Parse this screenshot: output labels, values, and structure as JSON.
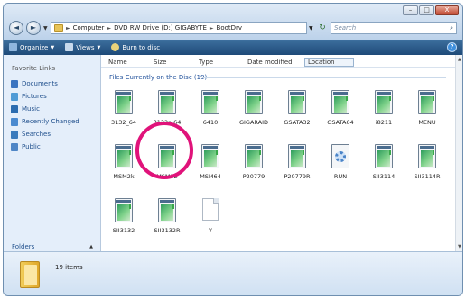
{
  "window": {
    "controls": {
      "minimize": "–",
      "maximize": "□",
      "close": "X"
    }
  },
  "nav": {
    "back_glyph": "◄",
    "forward_glyph": "►",
    "path": [
      "Computer",
      "DVD RW Drive (D:) GIGABYTE",
      "BootDrv"
    ],
    "search_placeholder": "Search"
  },
  "toolbar": {
    "organize": "Organize",
    "views": "Views",
    "burn": "Burn to disc",
    "help": "?"
  },
  "sidebar": {
    "title": "Favorite Links",
    "items": [
      {
        "label": "Documents",
        "icon": "documents-icon",
        "color": "#3b74c0"
      },
      {
        "label": "Pictures",
        "icon": "pictures-icon",
        "color": "#4f9bd6"
      },
      {
        "label": "Music",
        "icon": "music-icon",
        "color": "#2b6cb0"
      },
      {
        "label": "Recently Changed",
        "icon": "recent-icon",
        "color": "#4a8ad0"
      },
      {
        "label": "Searches",
        "icon": "searches-icon",
        "color": "#3a7bbd"
      },
      {
        "label": "Public",
        "icon": "public-icon",
        "color": "#4f86c6"
      }
    ],
    "folders_label": "Folders"
  },
  "columns": [
    "Name",
    "Size",
    "Type",
    "Date modified",
    "Location"
  ],
  "group": "Files Currently on the Disc (19)",
  "files": [
    {
      "name": "3132_64",
      "type": "exe"
    },
    {
      "name": "3132r_64",
      "type": "exe"
    },
    {
      "name": "6410",
      "type": "exe"
    },
    {
      "name": "GIGARAID",
      "type": "exe"
    },
    {
      "name": "GSATA32",
      "type": "exe"
    },
    {
      "name": "GSATA64",
      "type": "exe"
    },
    {
      "name": "i8211",
      "type": "exe"
    },
    {
      "name": "MENU",
      "type": "exe"
    },
    {
      "name": "MSM2k",
      "type": "exe"
    },
    {
      "name": "MSM32",
      "type": "exe"
    },
    {
      "name": "MSM64",
      "type": "exe"
    },
    {
      "name": "P20779",
      "type": "exe"
    },
    {
      "name": "P20779R",
      "type": "exe"
    },
    {
      "name": "RUN",
      "type": "gear"
    },
    {
      "name": "SII3114",
      "type": "exe"
    },
    {
      "name": "SII3114R",
      "type": "exe"
    },
    {
      "name": "SII3132",
      "type": "exe"
    },
    {
      "name": "SII3132R",
      "type": "exe"
    },
    {
      "name": "Y",
      "type": "blank"
    }
  ],
  "details": {
    "count": "19 items"
  },
  "colors": {
    "highlight": "#e0137a",
    "toolbar": "#2b5a89",
    "link": "#1f4f8c"
  }
}
